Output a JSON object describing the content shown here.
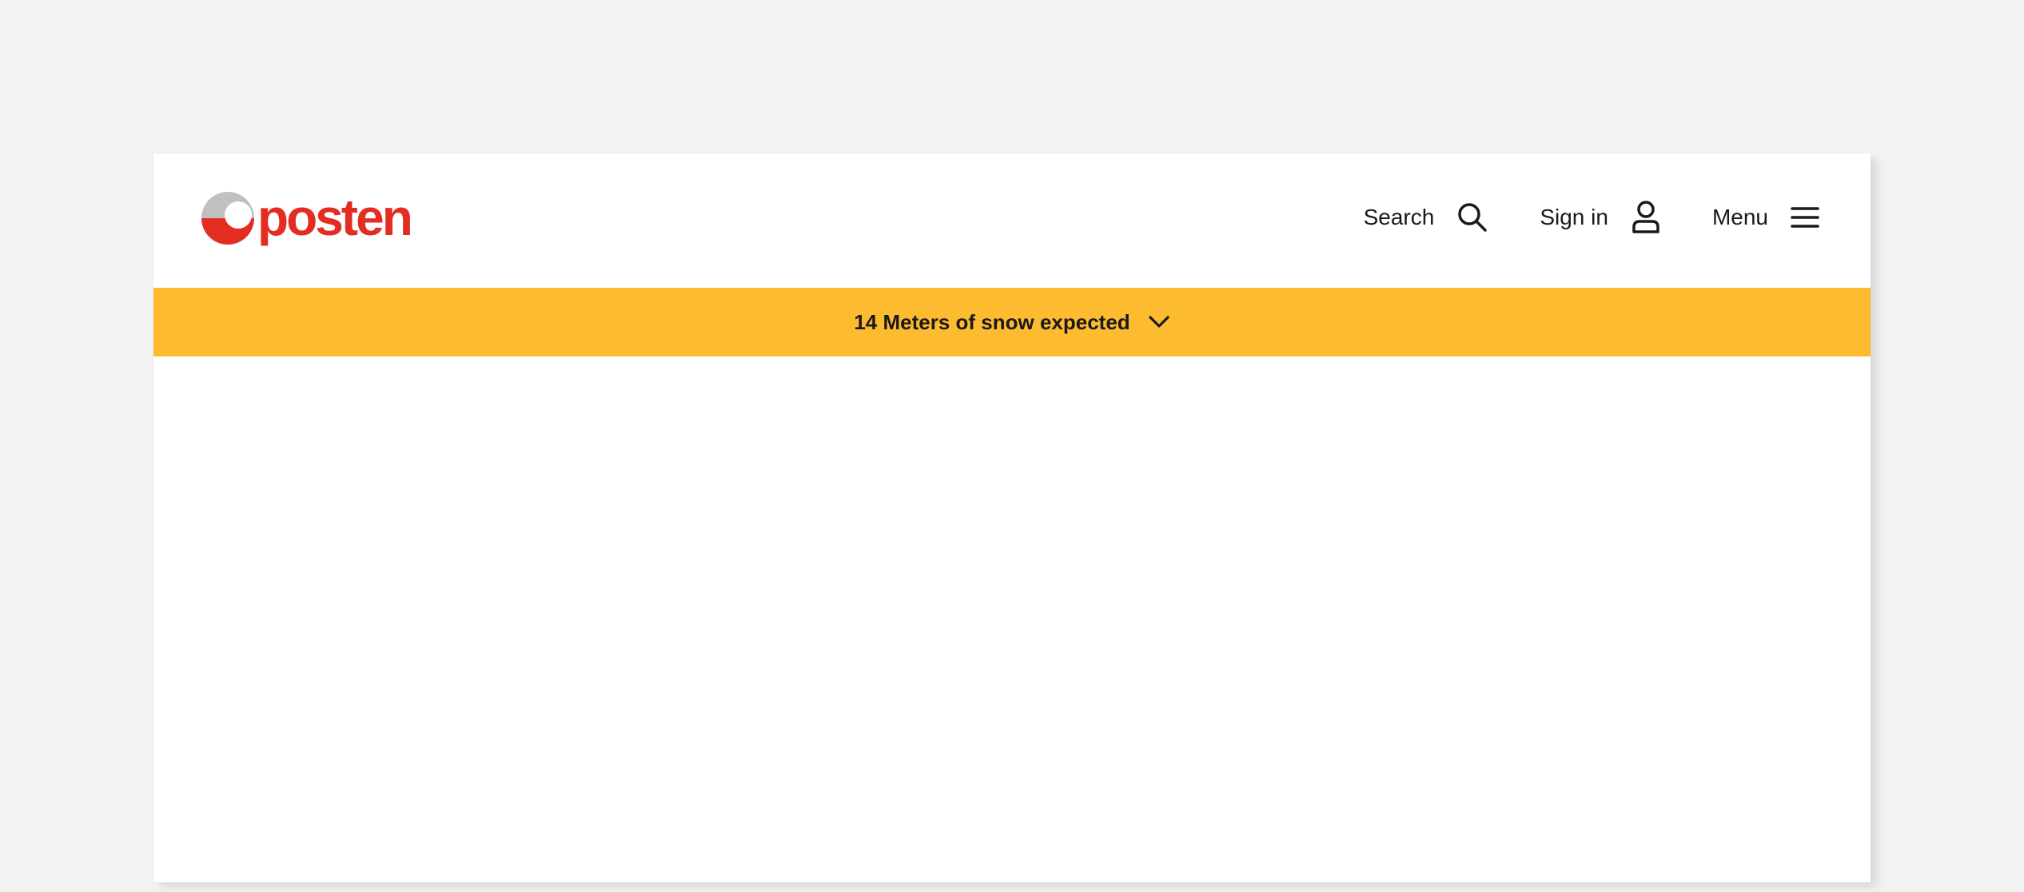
{
  "brand": {
    "name": "posten",
    "primary_color": "#e32d22",
    "ring_gray": "#c0c0c0"
  },
  "nav": {
    "search_label": "Search",
    "search_icon": "search-icon",
    "signin_label": "Sign in",
    "signin_icon": "user-icon",
    "menu_label": "Menu",
    "menu_icon": "hamburger-menu-icon"
  },
  "alert": {
    "text": "14 Meters of snow expected",
    "icon": "chevron-down-icon",
    "background_color": "#fdbb30"
  },
  "colors": {
    "page_background": "#f2f2f2",
    "surface": "#ffffff",
    "text": "#1a1a1a"
  }
}
